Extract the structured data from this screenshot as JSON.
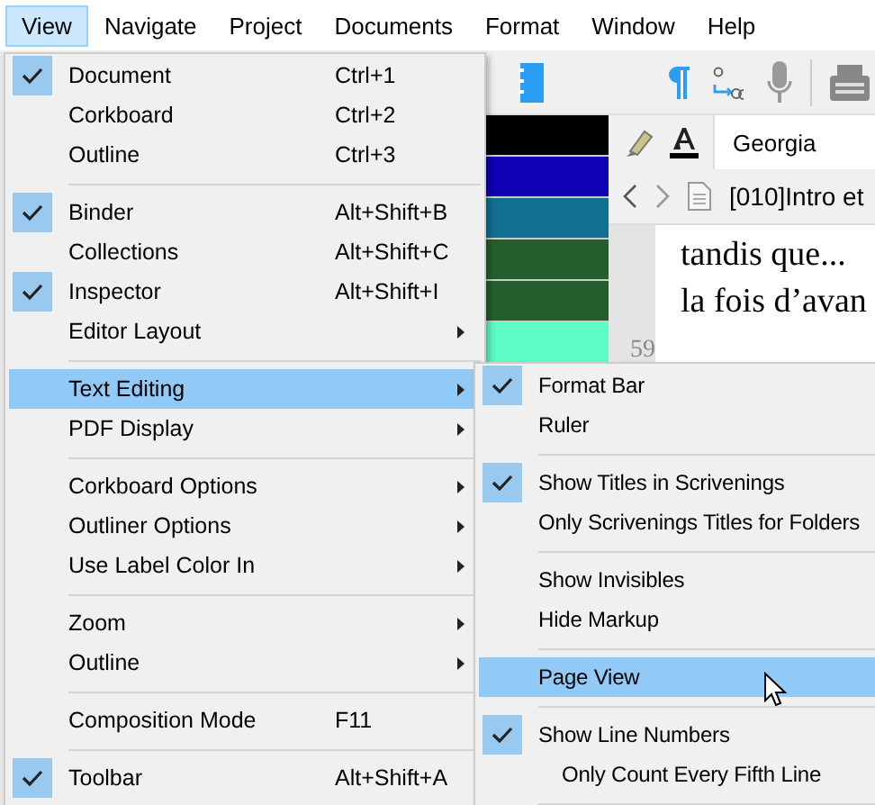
{
  "menubar": [
    {
      "label": "View",
      "selected": true
    },
    {
      "label": "Navigate",
      "selected": false
    },
    {
      "label": "Project",
      "selected": false
    },
    {
      "label": "Documents",
      "selected": false
    },
    {
      "label": "Format",
      "selected": false
    },
    {
      "label": "Window",
      "selected": false
    },
    {
      "label": "Help",
      "selected": false
    }
  ],
  "label_colors": [
    {
      "color": "#000000"
    },
    {
      "color": "#1000b4"
    },
    {
      "color": "#11708f"
    },
    {
      "color": "#245e2e"
    },
    {
      "color": "#245e2e"
    },
    {
      "color": "#5efbc5"
    }
  ],
  "format_bar": {
    "font": "Georgia"
  },
  "navigation": {
    "document": "[010]Intro et"
  },
  "editor": {
    "lines": [
      "tandis que...",
      "la fois d’avan"
    ],
    "line_number": "59"
  },
  "view_menu": {
    "items": [
      {
        "kind": "item",
        "label": "Document",
        "shortcut": "Ctrl+1",
        "checked": true,
        "submenu": false,
        "selected": false
      },
      {
        "kind": "item",
        "label": "Corkboard",
        "shortcut": "Ctrl+2",
        "checked": false,
        "submenu": false,
        "selected": false
      },
      {
        "kind": "item",
        "label": "Outline",
        "shortcut": "Ctrl+3",
        "checked": false,
        "submenu": false,
        "selected": false
      },
      {
        "kind": "separator"
      },
      {
        "kind": "item",
        "label": "Binder",
        "shortcut": "Alt+Shift+B",
        "checked": true,
        "submenu": false,
        "selected": false
      },
      {
        "kind": "item",
        "label": "Collections",
        "shortcut": "Alt+Shift+C",
        "checked": false,
        "submenu": false,
        "selected": false
      },
      {
        "kind": "item",
        "label": "Inspector",
        "shortcut": "Alt+Shift+I",
        "checked": true,
        "submenu": false,
        "selected": false
      },
      {
        "kind": "item",
        "label": "Editor Layout",
        "checked": false,
        "submenu": true,
        "selected": false
      },
      {
        "kind": "separator"
      },
      {
        "kind": "item",
        "label": "Text Editing",
        "checked": false,
        "submenu": true,
        "selected": true
      },
      {
        "kind": "item",
        "label": "PDF Display",
        "checked": false,
        "submenu": true,
        "selected": false
      },
      {
        "kind": "separator"
      },
      {
        "kind": "item",
        "label": "Corkboard Options",
        "checked": false,
        "submenu": true,
        "selected": false
      },
      {
        "kind": "item",
        "label": "Outliner Options",
        "checked": false,
        "submenu": true,
        "selected": false
      },
      {
        "kind": "item",
        "label": "Use Label Color In",
        "checked": false,
        "submenu": true,
        "selected": false
      },
      {
        "kind": "separator"
      },
      {
        "kind": "item",
        "label": "Zoom",
        "checked": false,
        "submenu": true,
        "selected": false
      },
      {
        "kind": "item",
        "label": "Outline",
        "checked": false,
        "submenu": true,
        "selected": false
      },
      {
        "kind": "separator"
      },
      {
        "kind": "item",
        "label": "Composition Mode",
        "shortcut": "F11",
        "checked": false,
        "submenu": false,
        "selected": false
      },
      {
        "kind": "separator"
      },
      {
        "kind": "item",
        "label": "Toolbar",
        "shortcut": "Alt+Shift+A",
        "checked": true,
        "submenu": false,
        "selected": false
      }
    ]
  },
  "text_editing_submenu": {
    "items": [
      {
        "kind": "item",
        "label": "Format Bar",
        "checked": true,
        "selected": false
      },
      {
        "kind": "item",
        "label": "Ruler",
        "checked": false,
        "selected": false
      },
      {
        "kind": "separator"
      },
      {
        "kind": "item",
        "label": "Show Titles in Scrivenings",
        "checked": true,
        "selected": false
      },
      {
        "kind": "item",
        "label": "Only Scrivenings Titles for Folders",
        "checked": false,
        "selected": false
      },
      {
        "kind": "separator"
      },
      {
        "kind": "item",
        "label": "Show Invisibles",
        "checked": false,
        "selected": false
      },
      {
        "kind": "item",
        "label": "Hide Markup",
        "checked": false,
        "selected": false
      },
      {
        "kind": "separator"
      },
      {
        "kind": "item",
        "label": "Page View",
        "checked": false,
        "selected": true
      },
      {
        "kind": "separator"
      },
      {
        "kind": "item",
        "label": "Show Line Numbers",
        "checked": true,
        "selected": false,
        "children": [
          {
            "kind": "item",
            "label": "Only Count Every Fifth Line",
            "checked": false,
            "selected": false
          }
        ]
      },
      {
        "kind": "separator"
      }
    ]
  }
}
